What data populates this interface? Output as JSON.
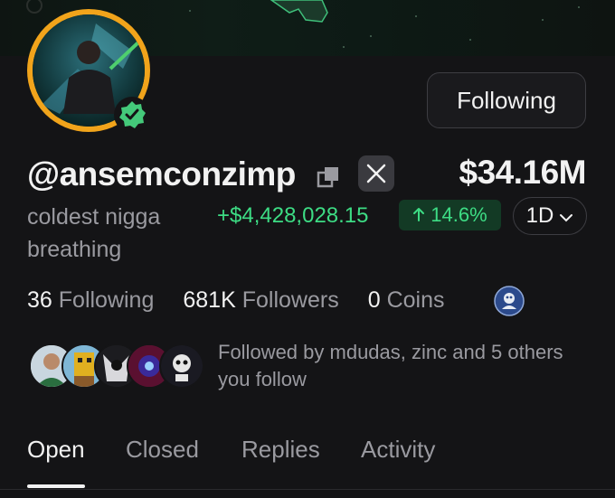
{
  "profile": {
    "handle": "@ansemconzimp",
    "bio": "coldest nigga breathing",
    "balance": "$34.16M",
    "pnl": "+$4,428,028.15",
    "pnl_pct": "14.6%",
    "period": "1D",
    "follow_button_label": "Following"
  },
  "stats": {
    "following_count": "36",
    "following_label": "Following",
    "followers_count": "681K",
    "followers_label": "Followers",
    "coins_count": "0",
    "coins_label": "Coins"
  },
  "followed_by": {
    "text": "Followed by mdudas, zinc and 5 others you follow"
  },
  "tabs": [
    {
      "label": "Open",
      "active": true
    },
    {
      "label": "Closed",
      "active": false
    },
    {
      "label": "Replies",
      "active": false
    },
    {
      "label": "Activity",
      "active": false
    }
  ],
  "colors": {
    "background": "#141416",
    "accent_green": "#3ddc84",
    "avatar_ring": "#f1a41b",
    "muted_text": "#9a9aa0"
  },
  "icons": {
    "verified": "verified-badge-icon",
    "copy": "copy-icon",
    "x": "x-logo-icon",
    "arrow_up": "arrow-up-icon",
    "chevron": "chevron-down-icon",
    "coin": "coin-icon"
  }
}
